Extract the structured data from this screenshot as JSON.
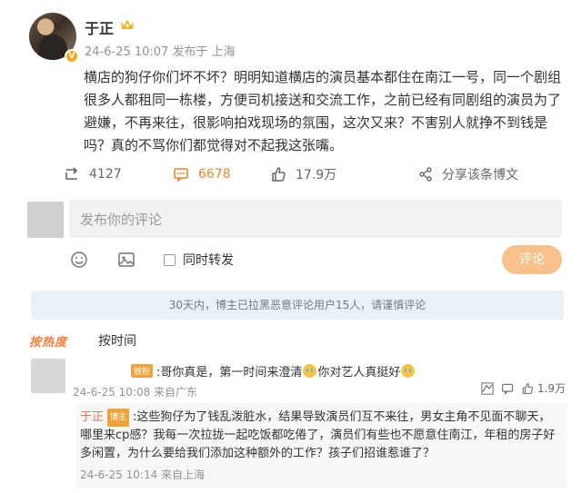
{
  "post": {
    "author": "于正",
    "timestamp": "24-6-25 10:07",
    "location": "发布于 上海",
    "body": "横店的狗仔你们坏不坏？明明知道横店的演员基本都住在南江一号，同一个剧组很多人都租同一栋楼，方便司机接送和交流工作，之前已经有同剧组的演员为了避嫌，不再来往，很影响拍戏现场的氛围，这次又来？不害别人就挣不到钱是吗？真的不骂你们都觉得对不起我这张嘴。"
  },
  "actions": {
    "repost_count": "4127",
    "comment_count": "6678",
    "like_count": "17.9万",
    "share_label": "分享该条博文"
  },
  "composer": {
    "placeholder": "发布你的评论",
    "repost_label": "同时转发",
    "submit_label": "评论"
  },
  "notice": "30天内，博主已拉黑恶意评论用户15人，请谨慎评论",
  "sort_tabs": {
    "hot": "按热度",
    "time": "按时间"
  },
  "comment": {
    "tag": "铁粉",
    "text_part1": ":哥你真是，第一时间来澄清",
    "text_part2": "你对艺人真挺好",
    "meta": "24-6-25 10:08 来自广东",
    "likes": "1.9万"
  },
  "reply": {
    "author": "于正",
    "tag": "博主",
    "text": ":这些狗仔为了钱乱泼脏水，结果导致演员们互不来往，男女主角不见面不聊天，哪里来cp感？我每一次拉拢一起吃饭都吃倦了，演员们有些也不愿意住南江，年租的房子好多闲置，为什么要给我们添加这种额外的工作？孩子们招谁惹谁了？",
    "meta": "24-6-25 10:14 来自上海"
  },
  "colors": {
    "accent": "#f8c18c",
    "active_action": "#e9862b",
    "notice_bg": "#eaf2f8",
    "hot_tab": "#fa7d3c"
  }
}
